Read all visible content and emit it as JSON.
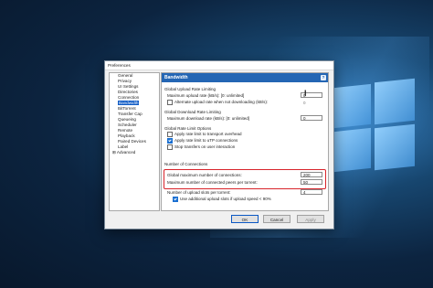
{
  "dialog": {
    "title": "Preferences",
    "tree_items": [
      {
        "label": "General",
        "expander": ""
      },
      {
        "label": "Privacy",
        "expander": ""
      },
      {
        "label": "UI Settings",
        "expander": ""
      },
      {
        "label": "Directories",
        "expander": ""
      },
      {
        "label": "Connection",
        "expander": ""
      },
      {
        "label": "Bandwidth",
        "expander": "",
        "selected": true
      },
      {
        "label": "BitTorrent",
        "expander": ""
      },
      {
        "label": "Transfer Cap",
        "expander": ""
      },
      {
        "label": "Queueing",
        "expander": ""
      },
      {
        "label": "Scheduler",
        "expander": ""
      },
      {
        "label": "Remote",
        "expander": ""
      },
      {
        "label": "Playback",
        "expander": ""
      },
      {
        "label": "Paired Devices",
        "expander": ""
      },
      {
        "label": "Label",
        "expander": ""
      },
      {
        "label": "Advanced",
        "expander": "⊞"
      }
    ],
    "panel": {
      "header": "Bandwidth",
      "help": "?",
      "upload_section": "Global Upload Rate Limiting",
      "max_upload_label": "Maximum upload rate (kB/s): [0: unlimited]",
      "max_upload_value": "0",
      "alt_upload_label": "Alternate upload rate when not downloading (kB/s):",
      "alt_upload_value": "0",
      "download_section": "Global Download Rate Limiting",
      "max_download_label": "Maximum download rate (kB/s): [0: unlimited]",
      "max_download_value": "0",
      "limit_section": "Global Rate Limit Options",
      "opt1": "Apply rate limit to transport overhead",
      "opt2": "Apply rate limit to uTP connections",
      "opt3": "Stop transfers on user interaction",
      "conn_section": "Number of Connections",
      "global_conn_label": "Global maximum number of connections:",
      "global_conn_value": "200",
      "peers_label": "Maximum number of connected peers per torrent:",
      "peers_value": "50",
      "slots_label": "Number of upload slots per torrent:",
      "slots_value": "4",
      "extra_slots_label": "Use additional upload slots if upload speed < 90%"
    },
    "buttons": {
      "ok": "OK",
      "cancel": "Cancel",
      "apply": "Apply"
    }
  },
  "colors": {
    "accent": "#2466b4",
    "highlight": "#d8242b"
  }
}
